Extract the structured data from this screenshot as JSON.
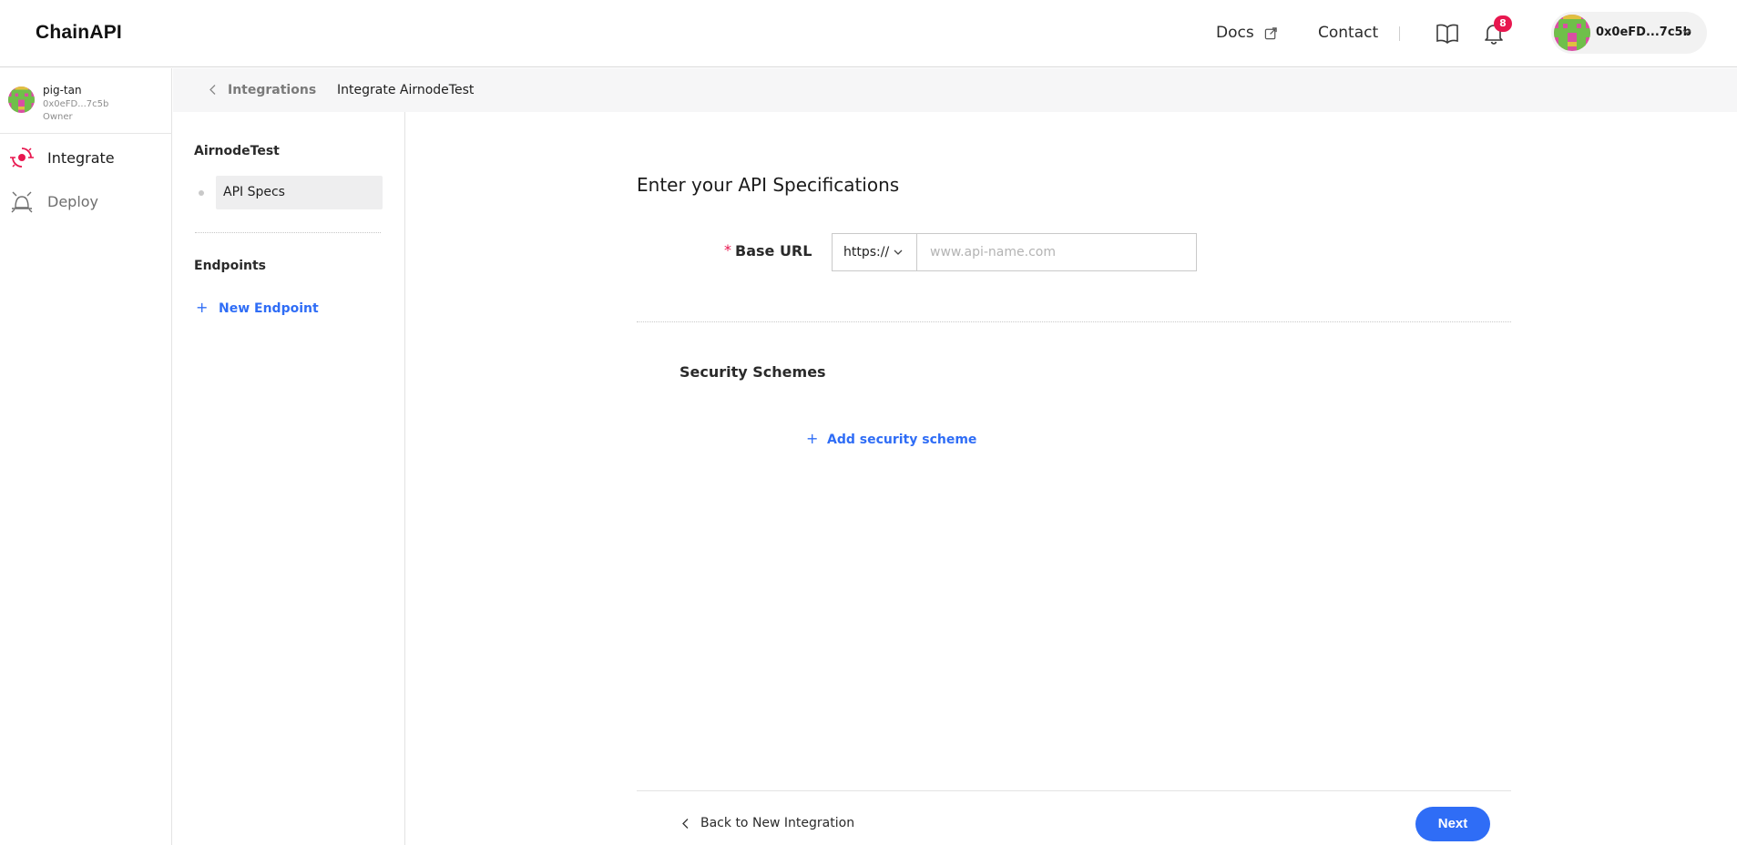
{
  "header": {
    "logo": "ChainAPI",
    "docs_label": "Docs",
    "contact_label": "Contact",
    "notification_count": "8",
    "account_label": "0x0eFD...7c5b"
  },
  "user": {
    "name": "pig-tan",
    "address": "0x0eFD...7c5b",
    "role": "Owner"
  },
  "nav": {
    "integrate": "Integrate",
    "deploy": "Deploy"
  },
  "breadcrumb": {
    "parent": "Integrations",
    "current": "Integrate AirnodeTest"
  },
  "integration_panel": {
    "title": "AirnodeTest",
    "item": "API Specs",
    "endpoints_title": "Endpoints",
    "new_endpoint": "New Endpoint"
  },
  "main": {
    "heading": "Enter your API Specifications",
    "base_url_required": "*",
    "base_url_label": "Base URL",
    "protocol": "https://",
    "url_placeholder": "www.api-name.com",
    "url_value": "",
    "security_title": "Security Schemes",
    "add_security": "Add security scheme",
    "back_label": "Back to New Integration",
    "next_label": "Next"
  },
  "colors": {
    "accent": "#2f6df6",
    "badge": "#e8174f",
    "integrate_icon": "#e8174f"
  },
  "icons": [
    "external-link-icon",
    "book-icon",
    "bell-icon",
    "chevron-down-icon",
    "integrate-icon",
    "deploy-icon",
    "chevron-left-icon",
    "plus-icon"
  ]
}
